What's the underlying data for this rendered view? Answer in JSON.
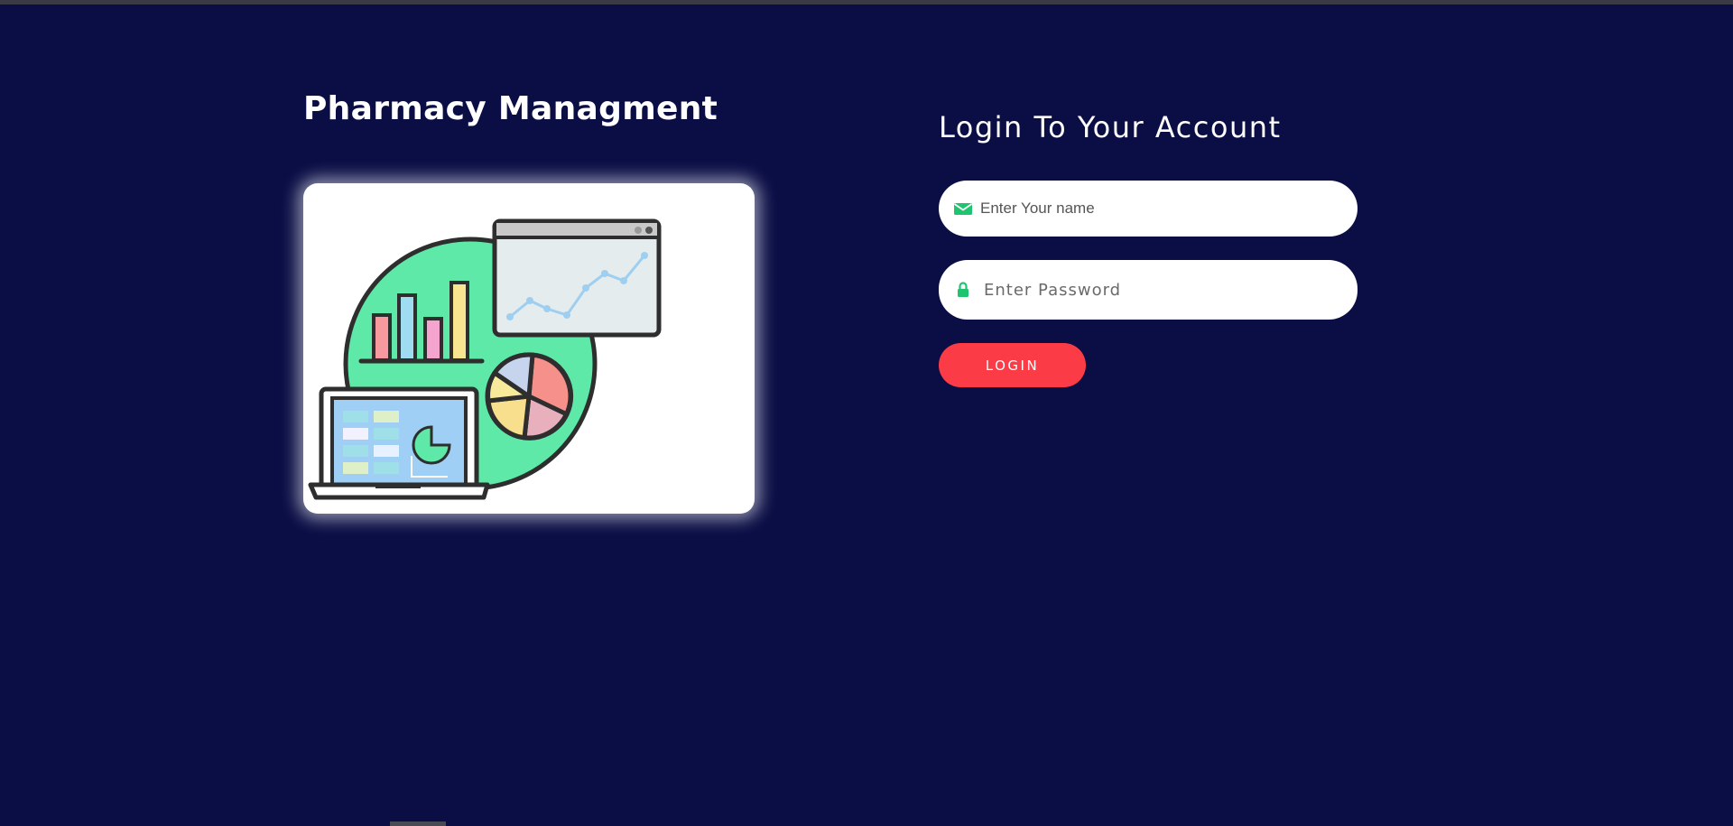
{
  "brand": {
    "title": "Pharmacy Managment"
  },
  "illustration": {
    "icon": "analytics-dashboard-illustration"
  },
  "login": {
    "heading": "Login To Your Account",
    "username": {
      "placeholder": "Enter Your name",
      "value": "",
      "icon": "envelope-icon"
    },
    "password": {
      "placeholder": "Enter Password",
      "value": "",
      "icon": "lock-icon"
    },
    "button_label": "LOGIN"
  },
  "colors": {
    "background": "#0a0e45",
    "accent_button": "#fb3c46",
    "icon_green": "#1fc46f",
    "illustration_green": "#5ee9a8"
  }
}
